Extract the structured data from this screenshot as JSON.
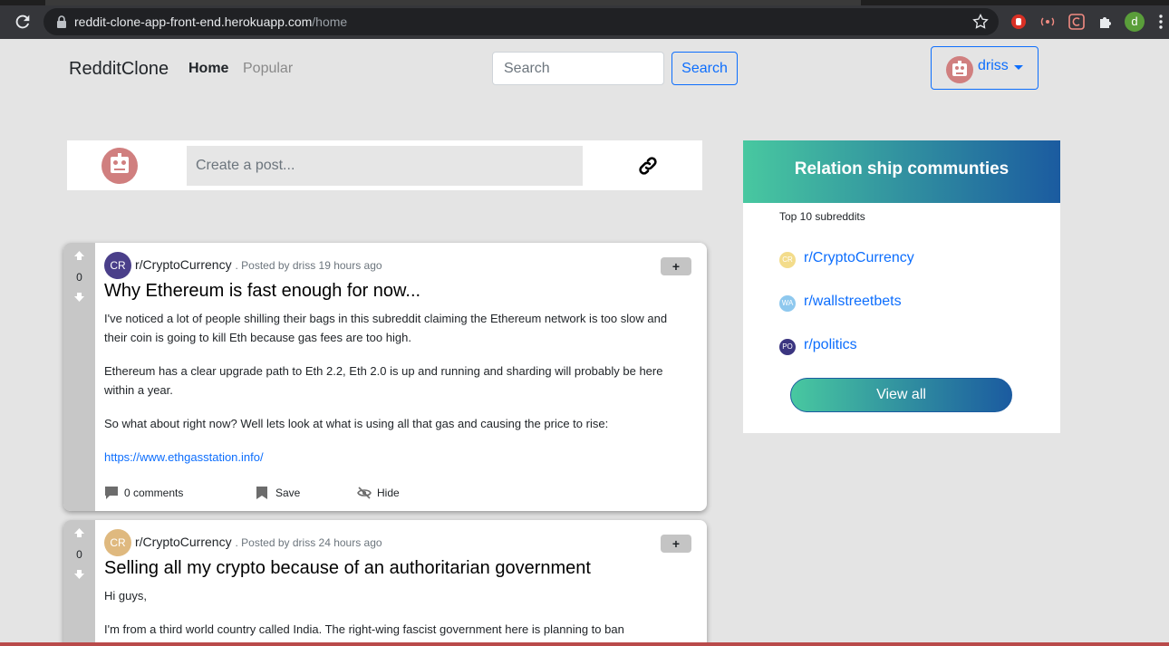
{
  "browser": {
    "url_host": "reddit-clone-app-front-end.herokuapp.com",
    "url_path": "/home",
    "profile_initial": "d"
  },
  "navbar": {
    "brand": "RedditClone",
    "links": {
      "home": "Home",
      "popular": "Popular"
    },
    "search": {
      "placeholder": "Search",
      "button": "Search"
    },
    "user": {
      "name": "driss"
    }
  },
  "create_post": {
    "placeholder": "Create a post..."
  },
  "posts": [
    {
      "votes": "0",
      "sub_initials": "CR",
      "sub_color": "#4a3f8a",
      "subreddit": "r/CryptoCurrency",
      "posted": ". Posted by driss 19 hours ago",
      "action_button": "+",
      "title": "Why Ethereum is fast enough for now...",
      "paragraphs": [
        "I've noticed a lot of people shilling their bags in this subreddit claiming the Ethereum network is too slow and their coin is going to kill Eth because gas fees are too high.",
        "Ethereum has a clear upgrade path to Eth 2.2, Eth 2.0 is up and running and sharding will probably be here within a year.",
        "So what about right now? Well lets look at what is using all that gas and causing the price to rise:"
      ],
      "link": "https://www.ethgasstation.info/",
      "actions": {
        "comments": "0 comments",
        "save": "Save",
        "hide": "Hide"
      }
    },
    {
      "votes": "0",
      "sub_initials": "CR",
      "sub_color": "#dfb97f",
      "subreddit": "r/CryptoCurrency",
      "posted": ". Posted by driss 24 hours ago",
      "action_button": "+",
      "title": "Selling all my crypto because of an authoritarian government",
      "paragraphs": [
        "Hi guys,",
        "I'm from a third world country called India. The right-wing fascist government here is planning to ban"
      ]
    }
  ],
  "sidebar": {
    "title": "Relation ship communties",
    "subtitle": "Top 10 subreddits",
    "communities": [
      {
        "initials": "CR",
        "name": "r/CryptoCurrency",
        "color": "#f3dc8b"
      },
      {
        "initials": "WA",
        "name": "r/wallstreetbets",
        "color": "#8ec8ee"
      },
      {
        "initials": "PO",
        "name": "r/politics",
        "color": "#3b3580"
      }
    ],
    "view_all": "View all"
  },
  "colors": {
    "accent": "#0d6efd",
    "gradient_start": "#48c8a0",
    "gradient_end": "#1b5ba0",
    "avatar": "#d07f7f"
  }
}
